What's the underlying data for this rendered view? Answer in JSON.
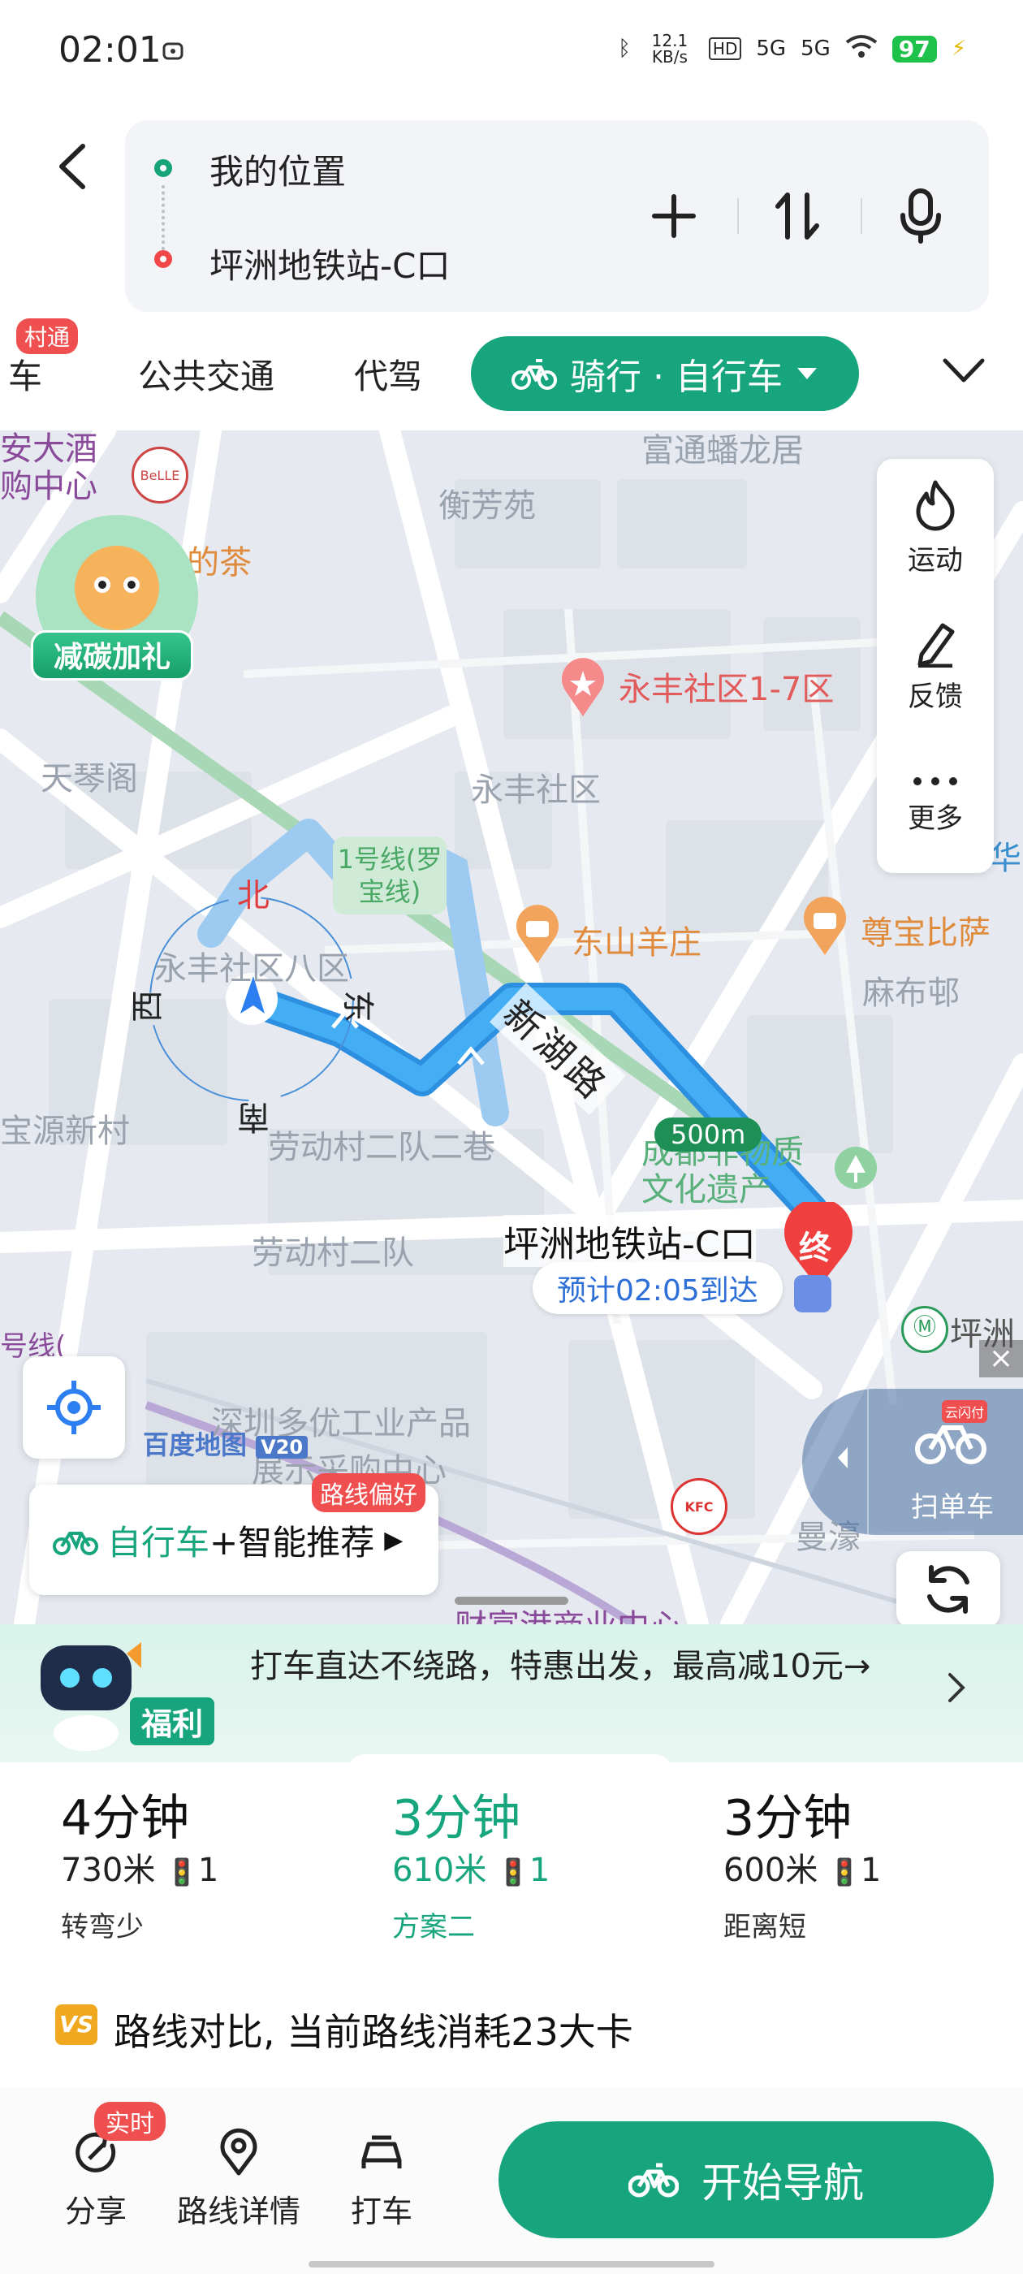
{
  "status_bar": {
    "time": "02:01",
    "net_speed": "12.1 KB/s",
    "signal_1": "5G",
    "signal_2": "5G",
    "battery": "97"
  },
  "route_card": {
    "origin": "我的位置",
    "destination": "坪洲地铁站-C口"
  },
  "tabs": {
    "partial_left": "车",
    "partial_badge": "村通",
    "items": [
      "公共交通",
      "代驾"
    ],
    "active": "骑行 · 自行车"
  },
  "map": {
    "labels": [
      "衡芳苑",
      "永丰社区",
      "天琴阁",
      "永丰社区八区",
      "劳动村二队二巷",
      "劳动村二队",
      "宝源新村",
      "麻布邨",
      "富通蟠龙居",
      "深圳多优工业产品",
      "展示采购中心",
      "财富港商业中心",
      "曼濠"
    ],
    "poi_labels": {
      "yongfeng_17": "永丰社区1-7区",
      "dongshan": "东山羊庄",
      "zunbao": "尊宝比萨",
      "tea": "的茶",
      "heritage": "成都非物质文化遗产",
      "metro_line": "1号线(罗宝线)"
    },
    "partial_labels": {
      "top_left_1": "安大酒",
      "top_left_2": "购中心",
      "left_line": "号线(",
      "hua": "华",
      "pingzhou": "坪洲"
    },
    "road_name": "新湖路",
    "compass": {
      "north": "北",
      "east": "东",
      "south": "南",
      "west": "西"
    },
    "scale": "500m",
    "destination_label": "坪洲地铁站-C口",
    "destination_pin": "终",
    "eta": "预计02:05到达",
    "mascot_banner": "减碳加礼",
    "watermark": "百度地图",
    "watermark_version": "V20",
    "side_panel": [
      "运动",
      "反馈",
      "更多"
    ],
    "scan_bike": "扫单车",
    "scan_badge": "云闪付",
    "route_pref_badge": "路线偏好",
    "route_pref_mode": "自行车",
    "route_pref_text": "+智能推荐",
    "kfc": "KFC"
  },
  "promo": {
    "badge": "福利",
    "text": "打车直达不绕路，特惠出发，最高减10元→"
  },
  "options": [
    {
      "time": "4分钟",
      "distance": "730米",
      "lights": "1",
      "tag": "转弯少",
      "selected": false
    },
    {
      "time": "3分钟",
      "distance": "610米",
      "lights": "1",
      "tag": "方案二",
      "selected": true
    },
    {
      "time": "3分钟",
      "distance": "600米",
      "lights": "1",
      "tag": "距离短",
      "selected": false
    }
  ],
  "compare": {
    "badge": "VS",
    "text": "路线对比, 当前路线消耗23大卡"
  },
  "footer": {
    "share": "分享",
    "share_badge": "实时",
    "details": "路线详情",
    "taxi": "打车",
    "start": "开始导航"
  },
  "colors": {
    "accent": "#17a57d",
    "route": "#3aa3e8",
    "destination": "#f04848"
  }
}
